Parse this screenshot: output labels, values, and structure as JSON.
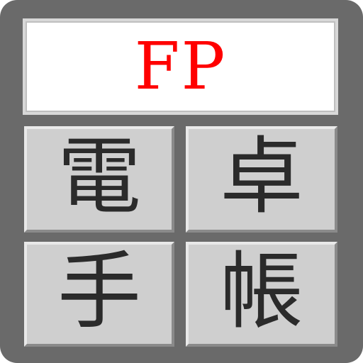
{
  "app": {
    "display_text": "FP",
    "keys": [
      {
        "label": "電"
      },
      {
        "label": "卓"
      },
      {
        "label": "手"
      },
      {
        "label": "帳"
      }
    ]
  },
  "colors": {
    "frame": "#6a6a6a",
    "display_bg": "#ffffff",
    "display_text": "#ff0000",
    "key_bg": "#cfcfcf",
    "key_text": "#2b2b2b"
  }
}
